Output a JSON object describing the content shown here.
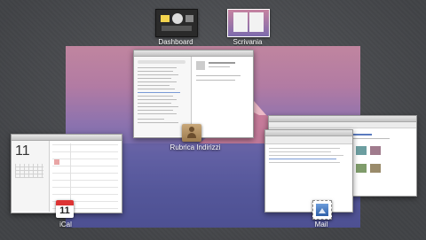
{
  "spaces": [
    {
      "label": "Dashboard"
    },
    {
      "label": "Scrivania"
    }
  ],
  "windows": {
    "address_book": {
      "label": "Rubrica Indirizzi",
      "icon": "address-book-icon"
    },
    "ical": {
      "label": "iCal",
      "icon": "calendar-icon",
      "day": "11"
    },
    "mail": {
      "label": "Mail",
      "icon": "mail-stamp-icon"
    }
  }
}
